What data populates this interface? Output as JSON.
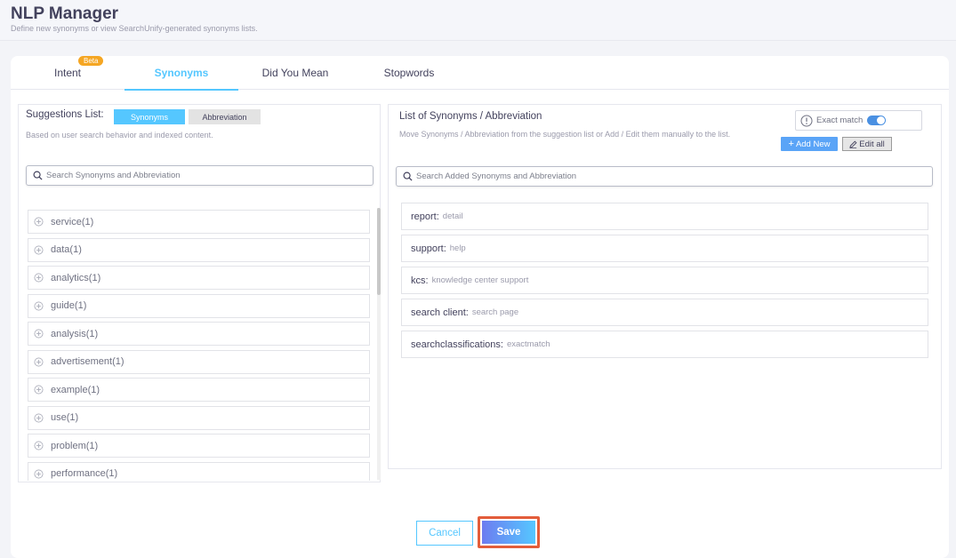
{
  "header": {
    "title": "NLP Manager",
    "subtitle": "Define new synonyms or view SearchUnify-generated synonyms lists."
  },
  "tabs": [
    {
      "label": "Intent",
      "badge": "Beta"
    },
    {
      "label": "Synonyms",
      "active": true
    },
    {
      "label": "Did You Mean"
    },
    {
      "label": "Stopwords"
    }
  ],
  "suggestions": {
    "title": "Suggestions List:",
    "toggle_synonyms": "Synonyms",
    "toggle_abbreviation": "Abbreviation",
    "description": "Based on user search behavior and indexed content.",
    "search_placeholder": "Search Synonyms and Abbreviation",
    "items": [
      "service(1)",
      "data(1)",
      "analytics(1)",
      "guide(1)",
      "analysis(1)",
      "advertisement(1)",
      "example(1)",
      "use(1)",
      "problem(1)",
      "performance(1)"
    ]
  },
  "synonym_list": {
    "title": "List of Synonyms / Abbreviation",
    "description": "Move Synonyms / Abbreviation from the suggestion list or Add / Edit them manually to the list.",
    "exact_match_label": "Exact match",
    "add_new_label": "Add New",
    "edit_all_label": "Edit all",
    "search_placeholder": "Search Added Synonyms and Abbreviation",
    "items": [
      {
        "key": "report:",
        "value": "detail"
      },
      {
        "key": "support:",
        "value": "help"
      },
      {
        "key": "kcs:",
        "value": "knowledge center support"
      },
      {
        "key": "search client:",
        "value": "search page"
      },
      {
        "key": "searchclassifications:",
        "value": "exactmatch"
      }
    ]
  },
  "footer": {
    "cancel_label": "Cancel",
    "save_label": "Save"
  },
  "colors": {
    "accent": "#55c7ff",
    "highlight_outline": "#e35d3a",
    "beta_badge": "#f5a623"
  }
}
